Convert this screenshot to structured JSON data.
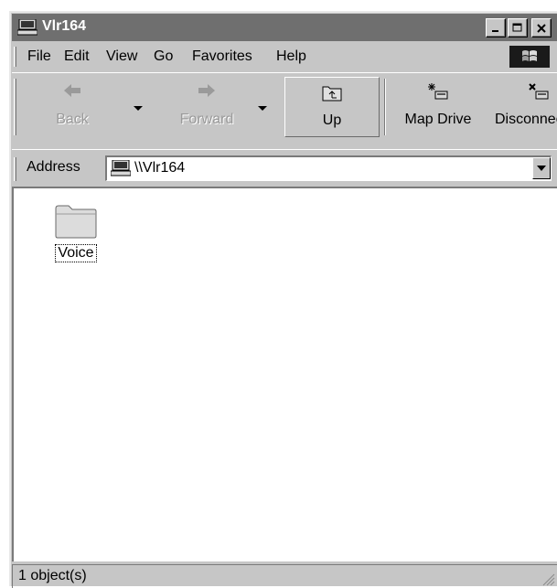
{
  "window": {
    "title": "Vlr164",
    "app_icon": "computer-icon"
  },
  "menu": {
    "items": [
      {
        "label": "File"
      },
      {
        "label": "Edit"
      },
      {
        "label": "View"
      },
      {
        "label": "Go"
      },
      {
        "label": "Favorites"
      },
      {
        "label": "Help"
      }
    ]
  },
  "toolbar": {
    "back_label": "Back",
    "forward_label": "Forward",
    "up_label": "Up",
    "map_drive_label": "Map Drive",
    "disconnect_label": "Disconnect"
  },
  "address": {
    "label": "Address",
    "value": "\\\\Vlr164"
  },
  "content": {
    "items": [
      {
        "name": "Voice",
        "icon": "folder-icon"
      }
    ]
  },
  "status": {
    "text": "1 object(s)"
  }
}
